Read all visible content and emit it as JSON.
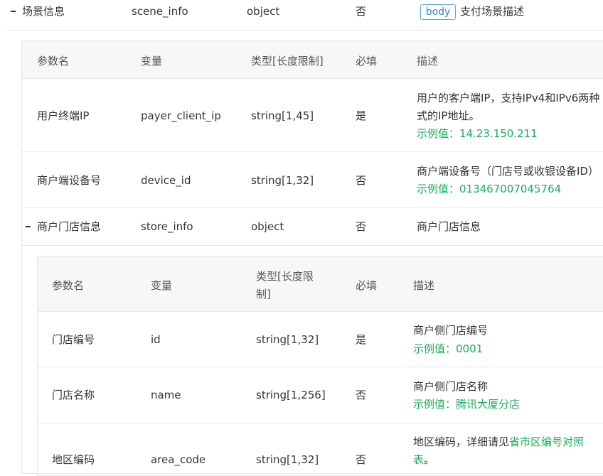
{
  "top_row": {
    "name": "场景信息",
    "variable": "scene_info",
    "type": "object",
    "required": "否",
    "badge": "body",
    "desc": "支付场景描述"
  },
  "table1": {
    "headers": {
      "name": "参数名",
      "variable": "变量",
      "type": "类型[长度限制]",
      "required": "必填",
      "desc": "描述"
    },
    "rows": [
      {
        "name": "用户终端IP",
        "variable": "payer_client_ip",
        "type": "string[1,45]",
        "required": "是",
        "desc_line1": "用户的客户端IP，支持IPv4和IPv6两种",
        "desc_line2": "式的IP地址。",
        "example": "示例值：14.23.150.211"
      },
      {
        "name": "商户端设备号",
        "variable": "device_id",
        "type": "string[1,32]",
        "required": "否",
        "desc_line1": "商户端设备号（门店号或收银设备ID）",
        "example": "示例值：013467007045764"
      },
      {
        "name": "商户门店信息",
        "variable": "store_info",
        "type": "object",
        "required": "否",
        "desc_line1": "商户门店信息"
      }
    ]
  },
  "table2": {
    "headers": {
      "name": "参数名",
      "variable": "变量",
      "type_line1": "类型[长度限",
      "type_line2": "制]",
      "required": "必填",
      "desc": "描述"
    },
    "rows": [
      {
        "name": "门店编号",
        "variable": "id",
        "type": "string[1,32]",
        "required": "是",
        "desc_line1": "商户侧门店编号",
        "example": "示例值：0001"
      },
      {
        "name": "门店名称",
        "variable": "name",
        "type": "string[1,256]",
        "required": "否",
        "desc_line1": "商户侧门店名称",
        "example": "示例值：腾讯大厦分店"
      },
      {
        "name": "地区编码",
        "variable": "area_code",
        "type": "string[1,32]",
        "required": "否",
        "desc_prefix": "地区编码，详细请见",
        "desc_link": "省市区编号对照",
        "desc_link_line2": "表",
        "desc_suffix": "。"
      }
    ]
  }
}
